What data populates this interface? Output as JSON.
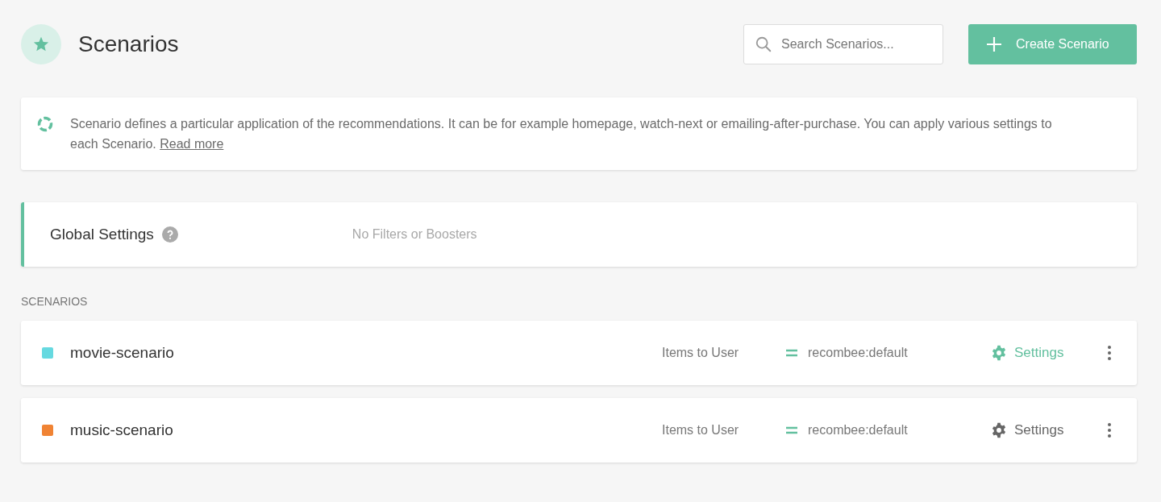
{
  "header": {
    "title": "Scenarios",
    "search": {
      "placeholder": "Search Scenarios..."
    },
    "create_button": "Create Scenario"
  },
  "info": {
    "text": "Scenario defines a particular application of the recommendations. It can be for example homepage, watch-next or emailing-after-purchase. You can apply various settings to each Scenario.",
    "link": "Read more"
  },
  "global_settings": {
    "title": "Global Settings",
    "summary": "No Filters or Boosters"
  },
  "section_label": "SCENARIOS",
  "scenarios": [
    {
      "name": "movie-scenario",
      "color": "#66d9e0",
      "type": "Items to User",
      "model": "recombee:default",
      "settings": {
        "label": "Settings",
        "highlighted": true
      }
    },
    {
      "name": "music-scenario",
      "color": "#f08334",
      "type": "Items to User",
      "model": "recombee:default",
      "settings": {
        "label": "Settings",
        "highlighted": false
      }
    }
  ]
}
